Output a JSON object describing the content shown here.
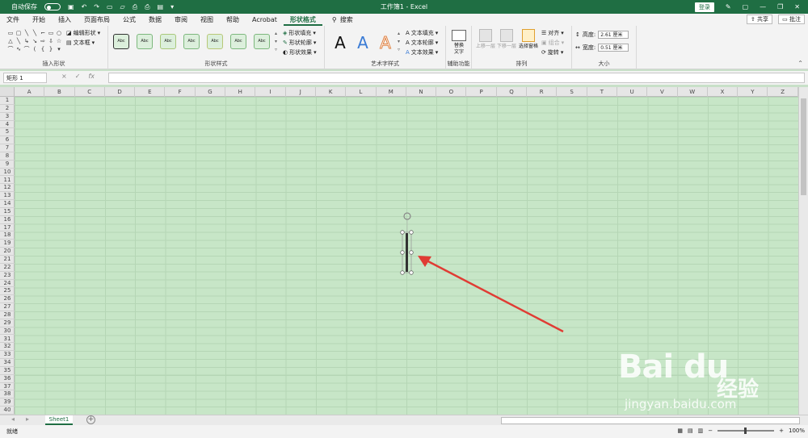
{
  "titlebar": {
    "autosave_label": "自动保存",
    "document_title": "工作簿1 - Excel",
    "login_label": "登录"
  },
  "tabs": [
    {
      "label": "文件"
    },
    {
      "label": "开始"
    },
    {
      "label": "插入"
    },
    {
      "label": "页面布局"
    },
    {
      "label": "公式"
    },
    {
      "label": "数据"
    },
    {
      "label": "审阅"
    },
    {
      "label": "视图"
    },
    {
      "label": "帮助"
    },
    {
      "label": "Acrobat"
    },
    {
      "label": "形状格式"
    }
  ],
  "search_label": "搜索",
  "share_label": "共享",
  "comment_label": "批注",
  "ribbon": {
    "insert_shapes": {
      "label": "插入形状",
      "edit_shape": "编辑形状",
      "text_box": "文本框"
    },
    "shape_styles": {
      "label": "形状样式",
      "sample": "Abc",
      "fill": "形状填充",
      "outline": "形状轮廓",
      "effects": "形状效果"
    },
    "wordart": {
      "label": "艺术字样式",
      "letter": "A",
      "text_fill": "文本填充",
      "text_outline": "文本轮廓",
      "text_effects": "文本效果"
    },
    "accessibility": {
      "label": "辅助功能",
      "alt_text_1": "替换",
      "alt_text_2": "文字"
    },
    "arrange": {
      "label": "排列",
      "bring_forward": "上移一层",
      "send_backward": "下移一层",
      "selection_pane": "选择窗格",
      "align": "对齐",
      "group": "组合",
      "rotate": "旋转"
    },
    "size": {
      "label": "大小",
      "height_label": "高度:",
      "height_value": "2.61 厘米",
      "width_label": "宽度:",
      "width_value": "0.51 厘米"
    }
  },
  "formula_bar": {
    "name_box": "矩形 1",
    "fx": "fx",
    "cancel": "×",
    "enter": "✓"
  },
  "columns": [
    "A",
    "B",
    "C",
    "D",
    "E",
    "F",
    "G",
    "H",
    "I",
    "J",
    "K",
    "L",
    "M",
    "N",
    "O",
    "P",
    "Q",
    "R",
    "S",
    "T",
    "U",
    "V",
    "W",
    "X",
    "Y",
    "Z"
  ],
  "rows": [
    "1",
    "2",
    "3",
    "4",
    "5",
    "6",
    "7",
    "8",
    "9",
    "10",
    "11",
    "12",
    "13",
    "14",
    "15",
    "16",
    "17",
    "18",
    "19",
    "20",
    "21",
    "22",
    "23",
    "24",
    "25",
    "26",
    "27",
    "28",
    "29",
    "30",
    "31",
    "32",
    "33",
    "34",
    "35",
    "36",
    "37",
    "38",
    "39",
    "40"
  ],
  "sheet_tab": "Sheet1",
  "add_sheet": "+",
  "status": "就绪",
  "zoom": "100%",
  "watermark": {
    "logo": "Bai du",
    "cn": "经验",
    "url": "jingyan.baidu.com"
  },
  "colors": {
    "accent": "#1f6e43",
    "annotation_arrow": "#e03c34",
    "grid_bg": "#c7e6c7"
  }
}
